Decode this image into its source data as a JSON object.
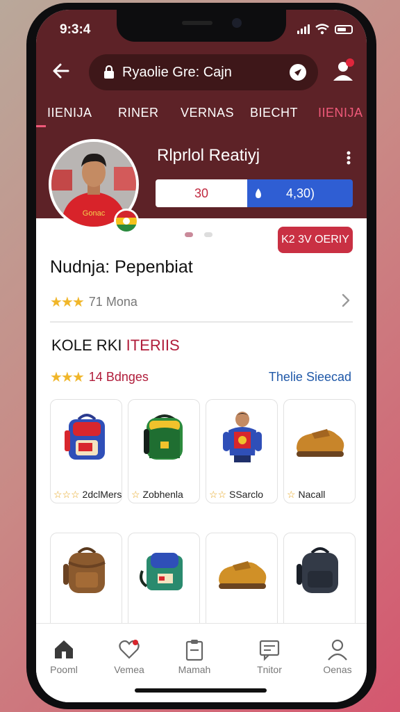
{
  "status_bar": {
    "time": "9:3:4"
  },
  "search": {
    "text": "Ryaolie Gre: Cajn"
  },
  "tabs": [
    {
      "label": "IIENIJA",
      "active": false
    },
    {
      "label": "RINER",
      "active": false
    },
    {
      "label": "VERNAS",
      "active": false
    },
    {
      "label": "BIECHT",
      "active": false
    },
    {
      "label": "IIENIJA",
      "active": true
    }
  ],
  "player": {
    "name": "Rlprlol Reatiyj",
    "stat_left": "30",
    "stat_right": "4,30)",
    "badge_text": "Gonac"
  },
  "cta": {
    "label": "K2 3V OERIY"
  },
  "section": {
    "title": "Nudnja: Pepenbiat",
    "rating_text": "71 Mona",
    "stars": "★★★"
  },
  "category": {
    "title_black": "KOLE RKI",
    "title_red": "ITERIIS",
    "rating_text": "14 Bdnges",
    "stars": "★★★",
    "see_all": "Thelie Sieecad"
  },
  "products": [
    {
      "label": "2dclMers",
      "stars": "☆☆☆",
      "icon": "backpack-blue-icon"
    },
    {
      "label": "Zobhenla",
      "stars": "☆",
      "icon": "backpack-green-icon"
    },
    {
      "label": "SSarclo",
      "stars": "☆☆",
      "icon": "player-figure-icon"
    },
    {
      "label": "Nacall",
      "stars": "☆",
      "icon": "shoe-brown-icon"
    },
    {
      "label": "",
      "stars": "",
      "icon": "backpack-brown-icon"
    },
    {
      "label": "",
      "stars": "",
      "icon": "bag-teal-icon"
    },
    {
      "label": "",
      "stars": "",
      "icon": "shoe-mustard-icon"
    },
    {
      "label": "",
      "stars": "",
      "icon": "backpack-dark-icon"
    }
  ],
  "bottom_nav": [
    {
      "label": "Pooml",
      "icon": "home-icon"
    },
    {
      "label": "Vemea",
      "icon": "heart-icon"
    },
    {
      "label": "Mamah",
      "icon": "clipboard-icon"
    },
    {
      "label": "Tnitor",
      "icon": "chat-icon"
    },
    {
      "label": "Oenas",
      "icon": "user-icon"
    }
  ],
  "colors": {
    "header": "#5d2227",
    "accent": "#c93043",
    "active_tab": "#f05a7a",
    "link": "#1f58a8",
    "stat_blue": "#2f5ed3"
  }
}
